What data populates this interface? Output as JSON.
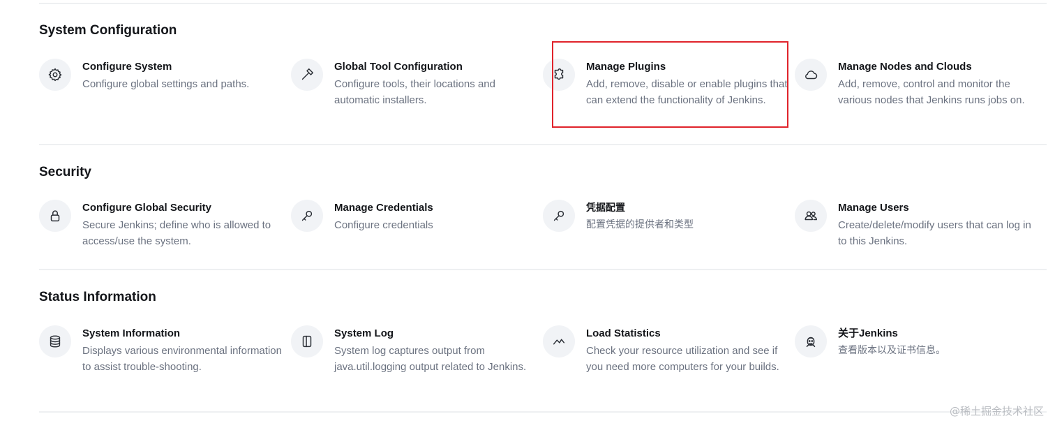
{
  "sections": [
    {
      "title": "System Configuration",
      "items": [
        {
          "title": "Configure System",
          "desc": "Configure global settings and paths.",
          "icon": "gear-icon"
        },
        {
          "title": "Global Tool Configuration",
          "desc": "Configure tools, their locations and automatic installers.",
          "icon": "hammer-icon"
        },
        {
          "title": "Manage Plugins",
          "desc": "Add, remove, disable or enable plugins that can extend the functionality of Jenkins.",
          "icon": "puzzle-icon"
        },
        {
          "title": "Manage Nodes and Clouds",
          "desc": "Add, remove, control and monitor the various nodes that Jenkins runs jobs on.",
          "icon": "cloud-icon"
        }
      ]
    },
    {
      "title": "Security",
      "items": [
        {
          "title": "Configure Global Security",
          "desc": "Secure Jenkins; define who is allowed to access/use the system.",
          "icon": "lock-icon"
        },
        {
          "title": "Manage Credentials",
          "desc": "Configure credentials",
          "icon": "key-icon"
        },
        {
          "title": "凭据配置",
          "desc": "配置凭据的提供者和类型",
          "icon": "key-icon"
        },
        {
          "title": "Manage Users",
          "desc": "Create/delete/modify users that can log in to this Jenkins.",
          "icon": "users-icon"
        }
      ]
    },
    {
      "title": "Status Information",
      "items": [
        {
          "title": "System Information",
          "desc": "Displays various environmental information to assist trouble-shooting.",
          "icon": "database-icon"
        },
        {
          "title": "System Log",
          "desc": "System log captures output from java.util.logging output related to Jenkins.",
          "icon": "log-panel-icon"
        },
        {
          "title": "Load Statistics",
          "desc": "Check your resource utilization and see if you need more computers for your builds.",
          "icon": "trend-line-icon"
        },
        {
          "title": "关于Jenkins",
          "desc": "查看版本以及证书信息。",
          "icon": "jenkins-butler-icon"
        }
      ]
    }
  ],
  "highlight_color": "#e0232b",
  "watermark": "@稀土掘金技术社区"
}
